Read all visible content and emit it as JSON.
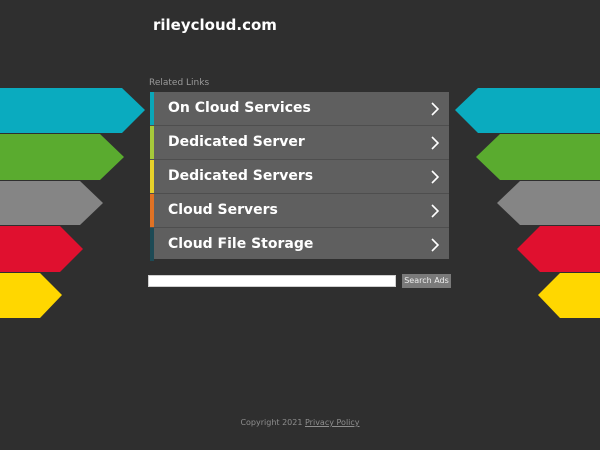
{
  "header": {
    "domain": "rileycloud.com"
  },
  "related": {
    "title": "Related Links",
    "items": [
      {
        "label": "On Cloud Services",
        "color": "#0aa6b8"
      },
      {
        "label": "Dedicated Server",
        "color": "#a6c93a"
      },
      {
        "label": "Dedicated Servers",
        "color": "#e8d22b"
      },
      {
        "label": "Cloud Servers",
        "color": "#e07224"
      },
      {
        "label": "Cloud File Storage",
        "color": "#1d4a55"
      }
    ]
  },
  "search": {
    "value": "",
    "button_label": "Search Ads"
  },
  "footer": {
    "copyright": "Copyright 2021",
    "privacy": "Privacy Policy"
  },
  "decor": {
    "stripe_colors": [
      "#0aabbf",
      "#5aab2f",
      "#858585",
      "#e0102f",
      "#ffd700"
    ]
  }
}
